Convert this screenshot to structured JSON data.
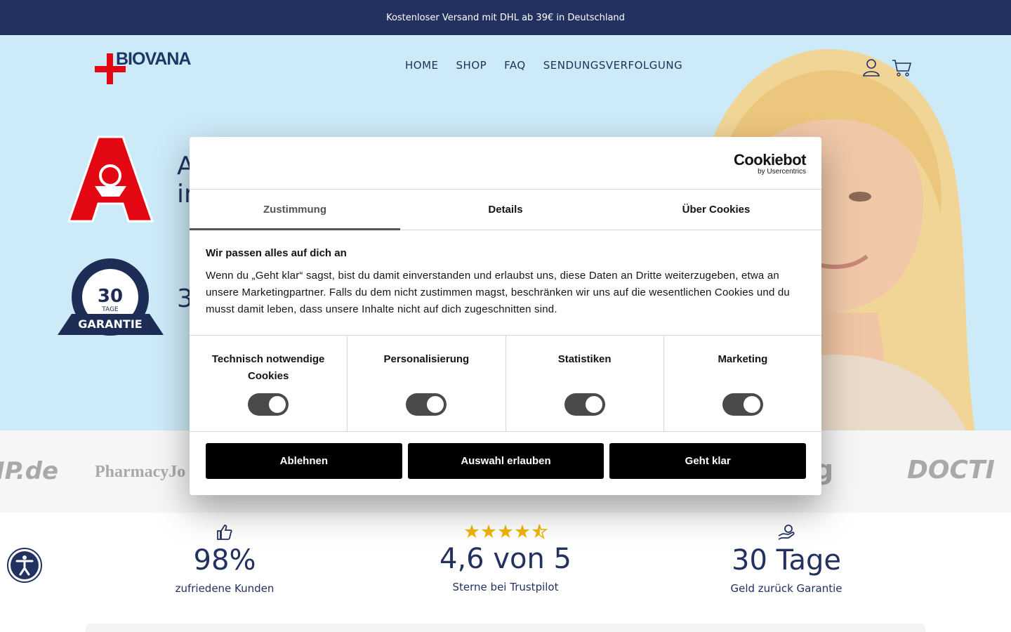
{
  "announcement": "Kostenloser Versand mit DHL ab 39€ in Deutschland",
  "logo": {
    "text": "BIOVANA"
  },
  "nav": [
    "HOME",
    "SHOP",
    "FAQ",
    "SENDUNGSVERFOLGUNG"
  ],
  "header_icons": [
    "account-icon",
    "cart-icon"
  ],
  "hero": {
    "line1": "A",
    "line2": "in",
    "line3": "3"
  },
  "badges": [
    "apotheke-icon",
    "garantie-badge"
  ],
  "press": [
    "IP.de",
    "PharmacyJo",
    "g",
    "DOCTI"
  ],
  "stats": [
    {
      "icon": "thumbs-up-icon",
      "value": "98%",
      "label": "zufriedene Kunden"
    },
    {
      "icon": "stars-icon",
      "value": "4,6 von 5",
      "label": "Sterne bei Trustpilot",
      "rating": 4.6
    },
    {
      "icon": "money-hand-icon",
      "value": "30 Tage",
      "label": "Geld zurück Garantie"
    }
  ],
  "cookie": {
    "brand": "Cookiebot",
    "brand_sub": "by Usercentrics",
    "tabs": [
      "Zustimmung",
      "Details",
      "Über Cookies"
    ],
    "heading": "Wir passen alles auf dich an",
    "text": "Wenn du „Geht klar“ sagst, bist du damit einverstanden und erlaubst uns, diese Daten an Dritte weiterzugeben, etwa an unsere Marketingpartner. Falls du dem nicht zustimmen magst, beschränken wir uns auf die wesentlichen Cookies und du musst damit leben, dass unsere Inhalte nicht auf dich zugeschnitten sind.",
    "categories": [
      "Technisch notwendige Cookies",
      "Personalisierung",
      "Statistiken",
      "Marketing"
    ],
    "buttons": [
      "Ablehnen",
      "Auswahl erlauben",
      "Geht klar"
    ]
  },
  "colors": {
    "navy": "#223160",
    "hero_bg": "#cdeaf8",
    "red": "#e30613",
    "gold": "#f0b400"
  }
}
